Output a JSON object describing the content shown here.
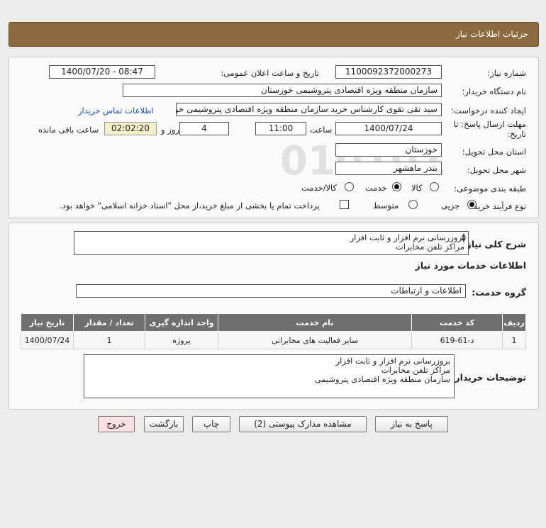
{
  "header": {
    "title": "جزئیات اطلاعات نیاز"
  },
  "form": {
    "need_number_label": "شماره نیاز:",
    "need_number": "1100092372000273",
    "announce_label": "تاریخ و ساعت اعلان عمومی:",
    "announce_value": "1400/07/20 - 08:47",
    "buyer_org_label": "نام دستگاه خریدار:",
    "buyer_org": "سازمان منطقه ویژه اقتصادی پتروشیمی خوزستان",
    "creator_label": "ایجاد کننده درخواست:",
    "creator": "سید تقی تقوی کارشناس خرید سازمان منطقه ویژه اقتصادی پتروشیمی خوزستان",
    "contact_link": "اطلاعات تماس خریدار",
    "deadline_label_1": "مهلت ارسال پاسخ: تا",
    "deadline_label_2": "تاریخ:",
    "deadline_date": "1400/07/24",
    "time_label": "ساعت",
    "deadline_time": "11:00",
    "days_value": "4",
    "days_label": "روز و",
    "remaining_time": "02:02:20",
    "remaining_label": "ساعت باقی مانده",
    "province_label": "استان محل تحویل:",
    "province": "خوزستان",
    "city_label": "شهر محل تحویل:",
    "city": "بندر ماهشهر",
    "category_label": "طبقه بندی موضوعی:",
    "category_options": [
      "کالا",
      "خدمت",
      "کالا/خدمت"
    ],
    "category_selected": "خدمت",
    "purchase_type_label": "نوع فرآیند خرید :",
    "purchase_options": [
      "جزیی",
      "متوسط"
    ],
    "purchase_selected": "جزیی",
    "payment_note": "پرداخت تمام یا بخشی از مبلغ خرید،از محل \"اسناد خزانه اسلامی\" خواهد بود."
  },
  "description": {
    "label": "شرح کلی نیاز:",
    "line1": "بروزرسانی نرم افزار و ثابت افزار",
    "line2": "مراکز تلفن مخابرات"
  },
  "services": {
    "section_title": "اطلاعات خدمات مورد نیاز",
    "group_label": "گروه خدمت:",
    "group_value": "اطلاعات و ارتباطات",
    "columns": [
      "ردیف",
      "کد خدمت",
      "نام خدمت",
      "واحد اندازه گیری",
      "تعداد / مقدار",
      "تاریخ نیاز"
    ],
    "rows": [
      [
        "1",
        "د-61-619",
        "سایر فعالیت های مخابراتی",
        "پروژه",
        "1",
        "1400/07/24"
      ]
    ]
  },
  "buyer_notes": {
    "label": "توضیحات خریدار:",
    "line1": "بروزرسانی نرم افزار و ثابت افزار",
    "line2": "مراکز تلفن مخابرات",
    "line3": "سازمان منطقه ویژه اقتصادی پتروشیمی"
  },
  "buttons": {
    "reply": "پاسخ به نیاز",
    "attachments": "مشاهده مدارک پیوستی (2)",
    "print": "چاپ",
    "back": "بازگشت",
    "exit": "خروج"
  },
  "colors": {
    "header": "#8b6a3f",
    "table_header": "#6f6f6f",
    "exit_button_bg": "#fbe0e6"
  }
}
